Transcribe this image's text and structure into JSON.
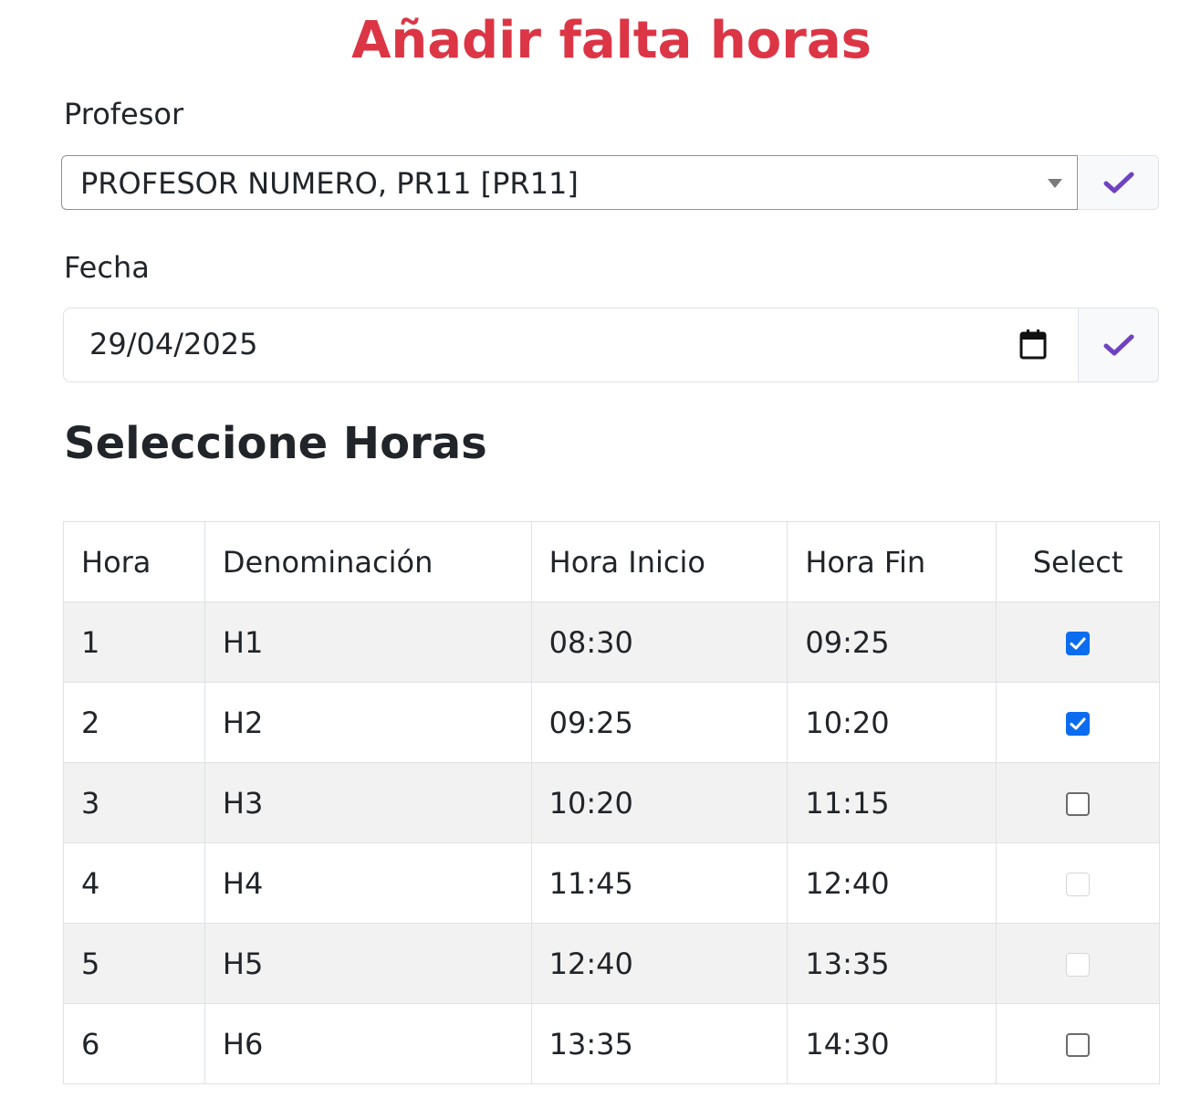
{
  "title": "Añadir falta horas",
  "profesor": {
    "label": "Profesor",
    "selected": "PROFESOR NUMERO, PR11 [PR11]"
  },
  "fecha": {
    "label": "Fecha",
    "value": "29/04/2025"
  },
  "section_title": "Seleccione Horas",
  "table": {
    "headers": [
      "Hora",
      "Denominación",
      "Hora Inicio",
      "Hora Fin",
      "Select"
    ],
    "rows": [
      {
        "hora": "1",
        "denominacion": "H1",
        "inicio": "08:30",
        "fin": "09:25",
        "select": "checked"
      },
      {
        "hora": "2",
        "denominacion": "H2",
        "inicio": "09:25",
        "fin": "10:20",
        "select": "checked"
      },
      {
        "hora": "3",
        "denominacion": "H3",
        "inicio": "10:20",
        "fin": "11:15",
        "select": "unchecked"
      },
      {
        "hora": "4",
        "denominacion": "H4",
        "inicio": "11:45",
        "fin": "12:40",
        "select": "disabled"
      },
      {
        "hora": "5",
        "denominacion": "H5",
        "inicio": "12:40",
        "fin": "13:35",
        "select": "disabled"
      },
      {
        "hora": "6",
        "denominacion": "H6",
        "inicio": "13:35",
        "fin": "14:30",
        "select": "unchecked"
      }
    ]
  },
  "colors": {
    "title": "#dc3545",
    "check_accent": "#6f42c1",
    "checkbox_checked": "#0b6cf0"
  },
  "icons": {
    "confirm": "checkmark-icon",
    "calendar": "calendar-icon",
    "dropdown": "caret-down-icon"
  }
}
